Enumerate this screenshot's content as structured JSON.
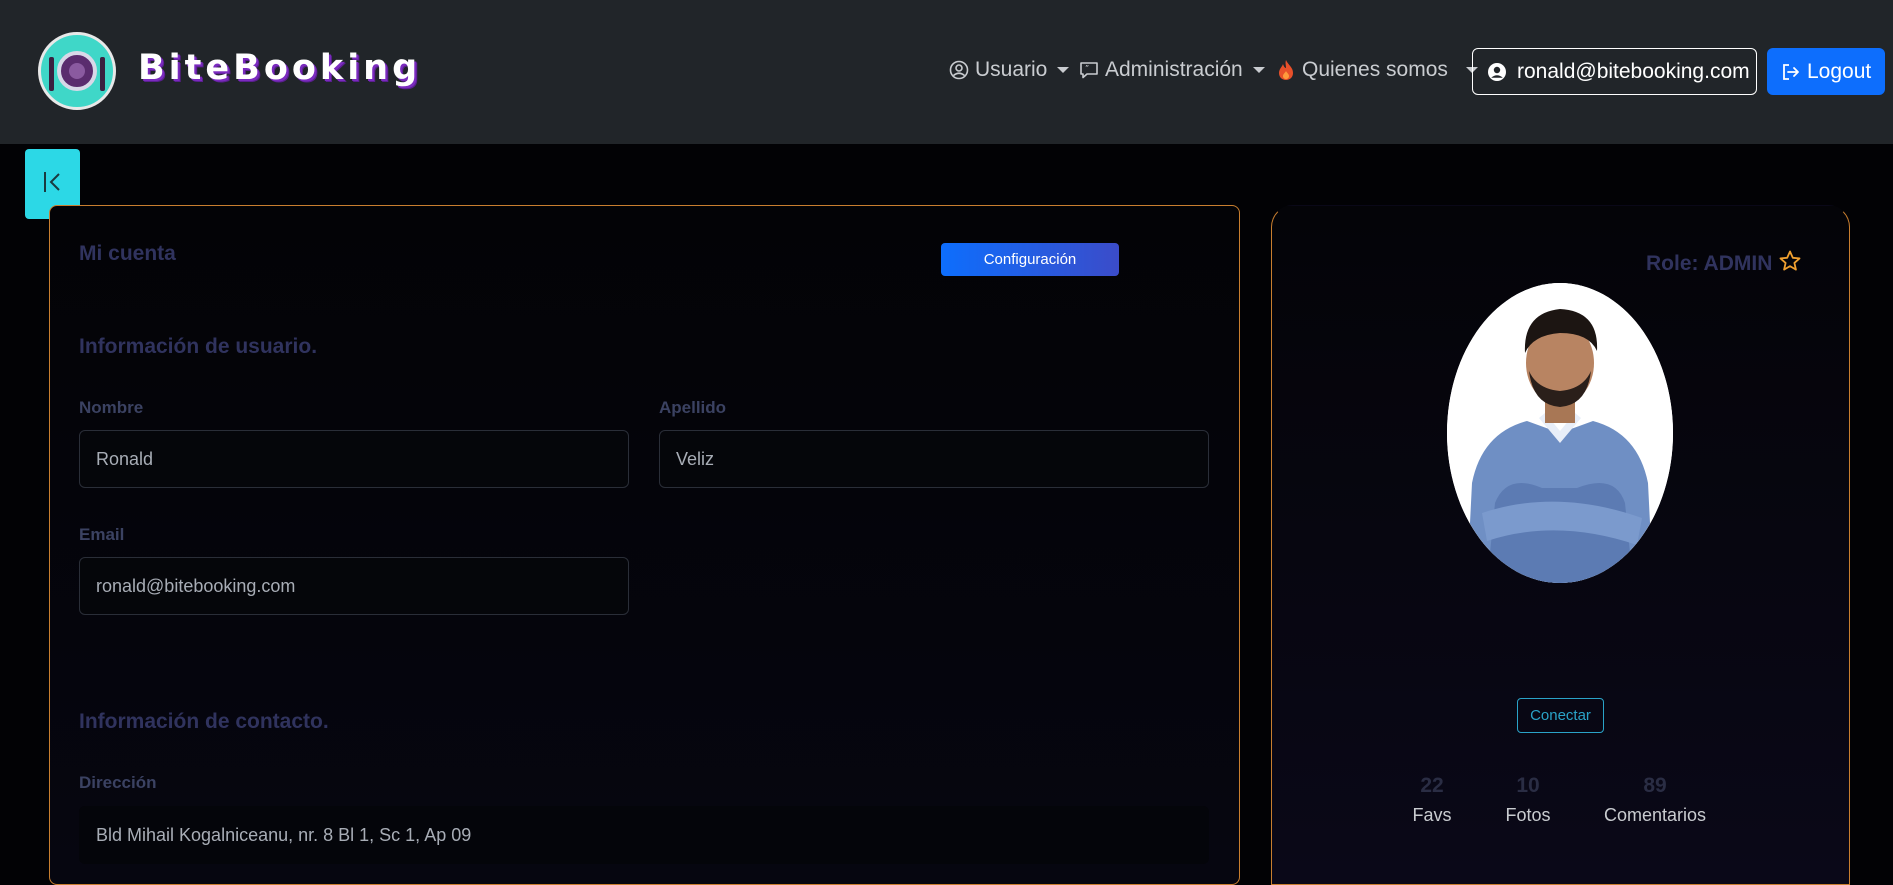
{
  "brand": {
    "name": "BiteBooking"
  },
  "nav": {
    "usuario": "Usuario",
    "administracion": "Administración",
    "quienes_somos": "Quienes somos",
    "user_email": "ronald@bitebooking.com",
    "logout": "Logout"
  },
  "account": {
    "title": "Mi cuenta",
    "config_button": "Configuración",
    "user_info_title": "Información de usuario.",
    "nombre_label": "Nombre",
    "nombre_value": "Ronald",
    "apellido_label": "Apellido",
    "apellido_value": "Veliz",
    "email_label": "Email",
    "email_value": "ronald@bitebooking.com",
    "contact_title": "Información de contacto.",
    "direccion_label": "Dirección",
    "direccion_value": "Bld Mihail Kogalniceanu, nr. 8 Bl 1, Sc 1, Ap 09"
  },
  "profile": {
    "role": "Role: ADMIN",
    "connect_button": "Conectar",
    "stats": [
      {
        "value": "22",
        "label": "Favs"
      },
      {
        "value": "10",
        "label": "Fotos"
      },
      {
        "value": "89",
        "label": "Comentarios"
      }
    ]
  },
  "colors": {
    "navbar": "#212529",
    "accent_blue": "#0d6efd",
    "toggle_cyan": "#2cd8e6",
    "card_border": "#c87e2f",
    "star": "#f0a030"
  },
  "icons": [
    "logo-icon",
    "user-circle-icon",
    "chat-quote-icon",
    "fire-icon",
    "user-circle-fill-icon",
    "logout-icon",
    "collapse-left-icon",
    "star-icon"
  ]
}
